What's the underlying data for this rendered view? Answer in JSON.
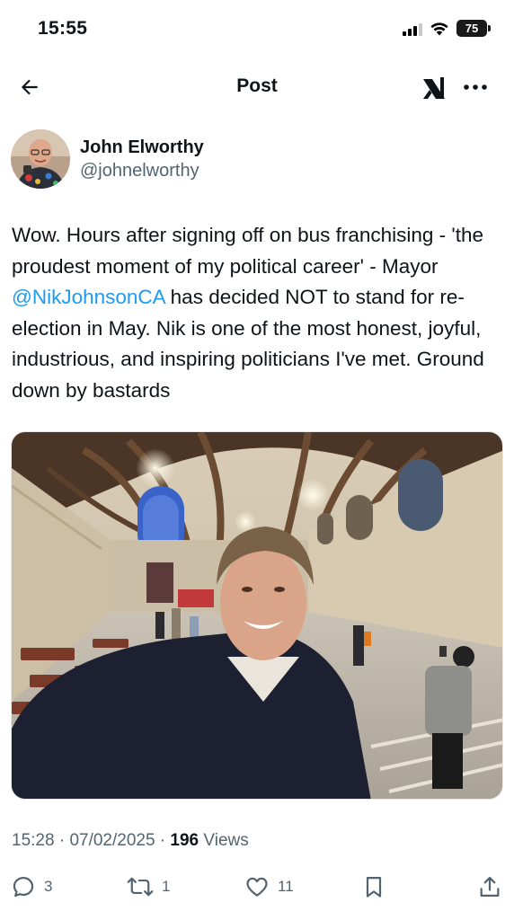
{
  "status_bar": {
    "time": "15:55",
    "battery": "75"
  },
  "header": {
    "title": "Post"
  },
  "author": {
    "display_name": "John Elworthy",
    "handle": "@johnelworthy"
  },
  "tweet": {
    "text_before_mention": "Wow. Hours after signing off on bus franchising - 'the proudest moment of my political career' - Mayor ",
    "mention": "@NikJohnsonCA",
    "text_after_mention": " has decided NOT to stand for re-election in May. Nik is one of the most honest, joyful, industrious, and inspiring politicians I've met. Ground down by bastards"
  },
  "meta": {
    "time": "15:28",
    "separator": " · ",
    "date": "07/02/2025",
    "separator2": " · ",
    "views_count": "196",
    "views_label": " Views"
  },
  "actions": {
    "replies": "3",
    "reposts": "1",
    "likes": "11"
  },
  "colors": {
    "accent": "#1d9bf0",
    "text": "#0f1419",
    "muted": "#536471"
  }
}
